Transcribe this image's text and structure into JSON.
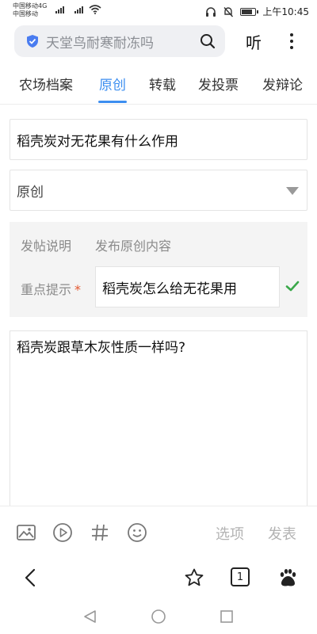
{
  "status_bar": {
    "carrier_line1": "中国移动4G",
    "carrier_line2": "中国移动",
    "time": "上午10:45"
  },
  "search": {
    "query": "天堂鸟耐寒耐冻吗",
    "listen_label": "听"
  },
  "tabs": [
    {
      "label": "农场档案"
    },
    {
      "label": "原创",
      "active": true
    },
    {
      "label": "转载"
    },
    {
      "label": "发投票"
    },
    {
      "label": "发辩论"
    }
  ],
  "form": {
    "title_value": "稻壳炭对无花果有什么作用",
    "type_value": "原创",
    "info_label_a": "发帖说明",
    "info_label_b": "发布原创内容",
    "key_label": "重点提示",
    "key_required_mark": "*",
    "key_value": "稻壳炭怎么给无花果用",
    "content_value": "稻壳炭跟草木灰性质一样吗?"
  },
  "editor_toolbar": {
    "options_label": "选项",
    "publish_label": "发表",
    "icons": [
      "image-icon",
      "video-icon",
      "hashtag-icon",
      "emoji-icon"
    ]
  },
  "browser_bar": {
    "tab_count": "1",
    "icons": [
      "back-icon",
      "star-icon",
      "tabs-icon",
      "baidu-icon"
    ]
  },
  "colors": {
    "accent": "#3c8ef0",
    "check": "#3aa84a",
    "required": "#e4572e",
    "muted": "#8a8a8a"
  }
}
